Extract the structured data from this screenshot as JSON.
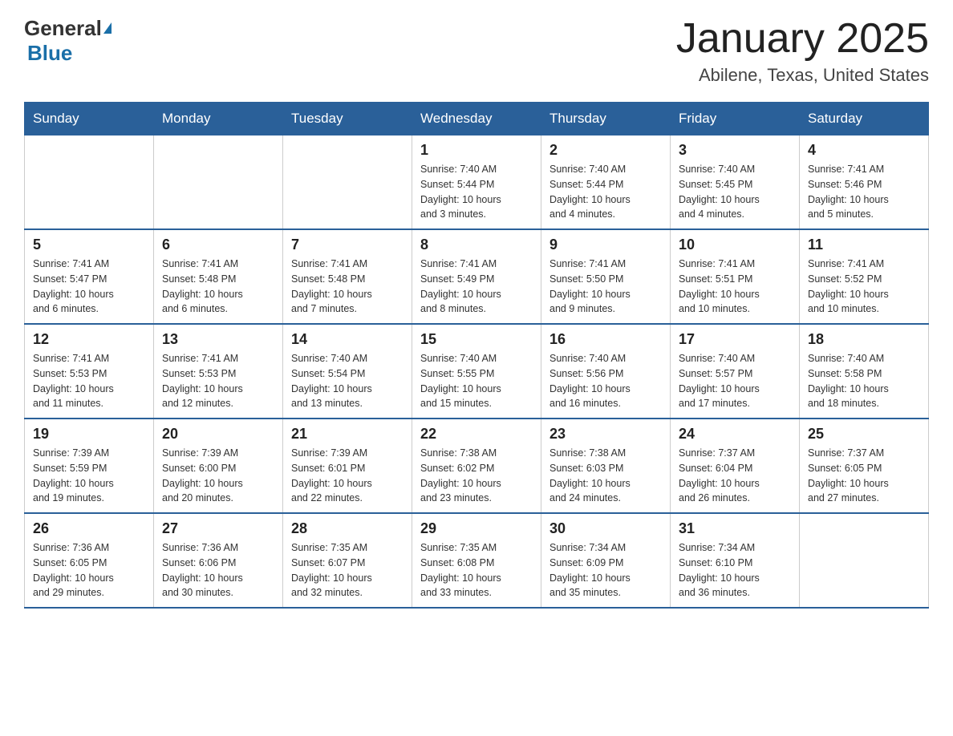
{
  "header": {
    "logo_general": "General",
    "logo_blue": "Blue",
    "title": "January 2025",
    "location": "Abilene, Texas, United States"
  },
  "weekdays": [
    "Sunday",
    "Monday",
    "Tuesday",
    "Wednesday",
    "Thursday",
    "Friday",
    "Saturday"
  ],
  "weeks": [
    [
      {
        "day": "",
        "info": ""
      },
      {
        "day": "",
        "info": ""
      },
      {
        "day": "",
        "info": ""
      },
      {
        "day": "1",
        "info": "Sunrise: 7:40 AM\nSunset: 5:44 PM\nDaylight: 10 hours\nand 3 minutes."
      },
      {
        "day": "2",
        "info": "Sunrise: 7:40 AM\nSunset: 5:44 PM\nDaylight: 10 hours\nand 4 minutes."
      },
      {
        "day": "3",
        "info": "Sunrise: 7:40 AM\nSunset: 5:45 PM\nDaylight: 10 hours\nand 4 minutes."
      },
      {
        "day": "4",
        "info": "Sunrise: 7:41 AM\nSunset: 5:46 PM\nDaylight: 10 hours\nand 5 minutes."
      }
    ],
    [
      {
        "day": "5",
        "info": "Sunrise: 7:41 AM\nSunset: 5:47 PM\nDaylight: 10 hours\nand 6 minutes."
      },
      {
        "day": "6",
        "info": "Sunrise: 7:41 AM\nSunset: 5:48 PM\nDaylight: 10 hours\nand 6 minutes."
      },
      {
        "day": "7",
        "info": "Sunrise: 7:41 AM\nSunset: 5:48 PM\nDaylight: 10 hours\nand 7 minutes."
      },
      {
        "day": "8",
        "info": "Sunrise: 7:41 AM\nSunset: 5:49 PM\nDaylight: 10 hours\nand 8 minutes."
      },
      {
        "day": "9",
        "info": "Sunrise: 7:41 AM\nSunset: 5:50 PM\nDaylight: 10 hours\nand 9 minutes."
      },
      {
        "day": "10",
        "info": "Sunrise: 7:41 AM\nSunset: 5:51 PM\nDaylight: 10 hours\nand 10 minutes."
      },
      {
        "day": "11",
        "info": "Sunrise: 7:41 AM\nSunset: 5:52 PM\nDaylight: 10 hours\nand 10 minutes."
      }
    ],
    [
      {
        "day": "12",
        "info": "Sunrise: 7:41 AM\nSunset: 5:53 PM\nDaylight: 10 hours\nand 11 minutes."
      },
      {
        "day": "13",
        "info": "Sunrise: 7:41 AM\nSunset: 5:53 PM\nDaylight: 10 hours\nand 12 minutes."
      },
      {
        "day": "14",
        "info": "Sunrise: 7:40 AM\nSunset: 5:54 PM\nDaylight: 10 hours\nand 13 minutes."
      },
      {
        "day": "15",
        "info": "Sunrise: 7:40 AM\nSunset: 5:55 PM\nDaylight: 10 hours\nand 15 minutes."
      },
      {
        "day": "16",
        "info": "Sunrise: 7:40 AM\nSunset: 5:56 PM\nDaylight: 10 hours\nand 16 minutes."
      },
      {
        "day": "17",
        "info": "Sunrise: 7:40 AM\nSunset: 5:57 PM\nDaylight: 10 hours\nand 17 minutes."
      },
      {
        "day": "18",
        "info": "Sunrise: 7:40 AM\nSunset: 5:58 PM\nDaylight: 10 hours\nand 18 minutes."
      }
    ],
    [
      {
        "day": "19",
        "info": "Sunrise: 7:39 AM\nSunset: 5:59 PM\nDaylight: 10 hours\nand 19 minutes."
      },
      {
        "day": "20",
        "info": "Sunrise: 7:39 AM\nSunset: 6:00 PM\nDaylight: 10 hours\nand 20 minutes."
      },
      {
        "day": "21",
        "info": "Sunrise: 7:39 AM\nSunset: 6:01 PM\nDaylight: 10 hours\nand 22 minutes."
      },
      {
        "day": "22",
        "info": "Sunrise: 7:38 AM\nSunset: 6:02 PM\nDaylight: 10 hours\nand 23 minutes."
      },
      {
        "day": "23",
        "info": "Sunrise: 7:38 AM\nSunset: 6:03 PM\nDaylight: 10 hours\nand 24 minutes."
      },
      {
        "day": "24",
        "info": "Sunrise: 7:37 AM\nSunset: 6:04 PM\nDaylight: 10 hours\nand 26 minutes."
      },
      {
        "day": "25",
        "info": "Sunrise: 7:37 AM\nSunset: 6:05 PM\nDaylight: 10 hours\nand 27 minutes."
      }
    ],
    [
      {
        "day": "26",
        "info": "Sunrise: 7:36 AM\nSunset: 6:05 PM\nDaylight: 10 hours\nand 29 minutes."
      },
      {
        "day": "27",
        "info": "Sunrise: 7:36 AM\nSunset: 6:06 PM\nDaylight: 10 hours\nand 30 minutes."
      },
      {
        "day": "28",
        "info": "Sunrise: 7:35 AM\nSunset: 6:07 PM\nDaylight: 10 hours\nand 32 minutes."
      },
      {
        "day": "29",
        "info": "Sunrise: 7:35 AM\nSunset: 6:08 PM\nDaylight: 10 hours\nand 33 minutes."
      },
      {
        "day": "30",
        "info": "Sunrise: 7:34 AM\nSunset: 6:09 PM\nDaylight: 10 hours\nand 35 minutes."
      },
      {
        "day": "31",
        "info": "Sunrise: 7:34 AM\nSunset: 6:10 PM\nDaylight: 10 hours\nand 36 minutes."
      },
      {
        "day": "",
        "info": ""
      }
    ]
  ]
}
